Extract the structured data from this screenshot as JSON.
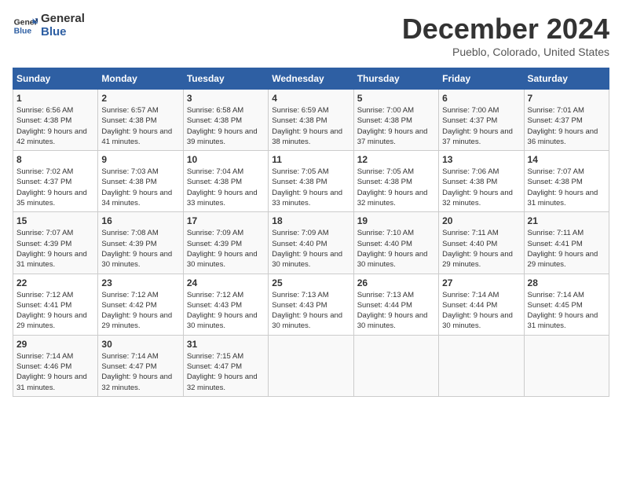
{
  "header": {
    "logo_line1": "General",
    "logo_line2": "Blue",
    "title": "December 2024",
    "subtitle": "Pueblo, Colorado, United States"
  },
  "days_of_week": [
    "Sunday",
    "Monday",
    "Tuesday",
    "Wednesday",
    "Thursday",
    "Friday",
    "Saturday"
  ],
  "weeks": [
    [
      {
        "day": "1",
        "sunrise": "6:56 AM",
        "sunset": "4:38 PM",
        "daylight": "9 hours and 42 minutes."
      },
      {
        "day": "2",
        "sunrise": "6:57 AM",
        "sunset": "4:38 PM",
        "daylight": "9 hours and 41 minutes."
      },
      {
        "day": "3",
        "sunrise": "6:58 AM",
        "sunset": "4:38 PM",
        "daylight": "9 hours and 39 minutes."
      },
      {
        "day": "4",
        "sunrise": "6:59 AM",
        "sunset": "4:38 PM",
        "daylight": "9 hours and 38 minutes."
      },
      {
        "day": "5",
        "sunrise": "7:00 AM",
        "sunset": "4:38 PM",
        "daylight": "9 hours and 37 minutes."
      },
      {
        "day": "6",
        "sunrise": "7:00 AM",
        "sunset": "4:37 PM",
        "daylight": "9 hours and 37 minutes."
      },
      {
        "day": "7",
        "sunrise": "7:01 AM",
        "sunset": "4:37 PM",
        "daylight": "9 hours and 36 minutes."
      }
    ],
    [
      {
        "day": "8",
        "sunrise": "7:02 AM",
        "sunset": "4:37 PM",
        "daylight": "9 hours and 35 minutes."
      },
      {
        "day": "9",
        "sunrise": "7:03 AM",
        "sunset": "4:38 PM",
        "daylight": "9 hours and 34 minutes."
      },
      {
        "day": "10",
        "sunrise": "7:04 AM",
        "sunset": "4:38 PM",
        "daylight": "9 hours and 33 minutes."
      },
      {
        "day": "11",
        "sunrise": "7:05 AM",
        "sunset": "4:38 PM",
        "daylight": "9 hours and 33 minutes."
      },
      {
        "day": "12",
        "sunrise": "7:05 AM",
        "sunset": "4:38 PM",
        "daylight": "9 hours and 32 minutes."
      },
      {
        "day": "13",
        "sunrise": "7:06 AM",
        "sunset": "4:38 PM",
        "daylight": "9 hours and 32 minutes."
      },
      {
        "day": "14",
        "sunrise": "7:07 AM",
        "sunset": "4:38 PM",
        "daylight": "9 hours and 31 minutes."
      }
    ],
    [
      {
        "day": "15",
        "sunrise": "7:07 AM",
        "sunset": "4:39 PM",
        "daylight": "9 hours and 31 minutes."
      },
      {
        "day": "16",
        "sunrise": "7:08 AM",
        "sunset": "4:39 PM",
        "daylight": "9 hours and 30 minutes."
      },
      {
        "day": "17",
        "sunrise": "7:09 AM",
        "sunset": "4:39 PM",
        "daylight": "9 hours and 30 minutes."
      },
      {
        "day": "18",
        "sunrise": "7:09 AM",
        "sunset": "4:40 PM",
        "daylight": "9 hours and 30 minutes."
      },
      {
        "day": "19",
        "sunrise": "7:10 AM",
        "sunset": "4:40 PM",
        "daylight": "9 hours and 30 minutes."
      },
      {
        "day": "20",
        "sunrise": "7:11 AM",
        "sunset": "4:40 PM",
        "daylight": "9 hours and 29 minutes."
      },
      {
        "day": "21",
        "sunrise": "7:11 AM",
        "sunset": "4:41 PM",
        "daylight": "9 hours and 29 minutes."
      }
    ],
    [
      {
        "day": "22",
        "sunrise": "7:12 AM",
        "sunset": "4:41 PM",
        "daylight": "9 hours and 29 minutes."
      },
      {
        "day": "23",
        "sunrise": "7:12 AM",
        "sunset": "4:42 PM",
        "daylight": "9 hours and 29 minutes."
      },
      {
        "day": "24",
        "sunrise": "7:12 AM",
        "sunset": "4:43 PM",
        "daylight": "9 hours and 30 minutes."
      },
      {
        "day": "25",
        "sunrise": "7:13 AM",
        "sunset": "4:43 PM",
        "daylight": "9 hours and 30 minutes."
      },
      {
        "day": "26",
        "sunrise": "7:13 AM",
        "sunset": "4:44 PM",
        "daylight": "9 hours and 30 minutes."
      },
      {
        "day": "27",
        "sunrise": "7:14 AM",
        "sunset": "4:44 PM",
        "daylight": "9 hours and 30 minutes."
      },
      {
        "day": "28",
        "sunrise": "7:14 AM",
        "sunset": "4:45 PM",
        "daylight": "9 hours and 31 minutes."
      }
    ],
    [
      {
        "day": "29",
        "sunrise": "7:14 AM",
        "sunset": "4:46 PM",
        "daylight": "9 hours and 31 minutes."
      },
      {
        "day": "30",
        "sunrise": "7:14 AM",
        "sunset": "4:47 PM",
        "daylight": "9 hours and 32 minutes."
      },
      {
        "day": "31",
        "sunrise": "7:15 AM",
        "sunset": "4:47 PM",
        "daylight": "9 hours and 32 minutes."
      },
      null,
      null,
      null,
      null
    ]
  ],
  "labels": {
    "sunrise": "Sunrise:",
    "sunset": "Sunset:",
    "daylight": "Daylight:"
  },
  "colors": {
    "header_bg": "#2e5fa3",
    "logo_blue": "#2e5fa3"
  }
}
